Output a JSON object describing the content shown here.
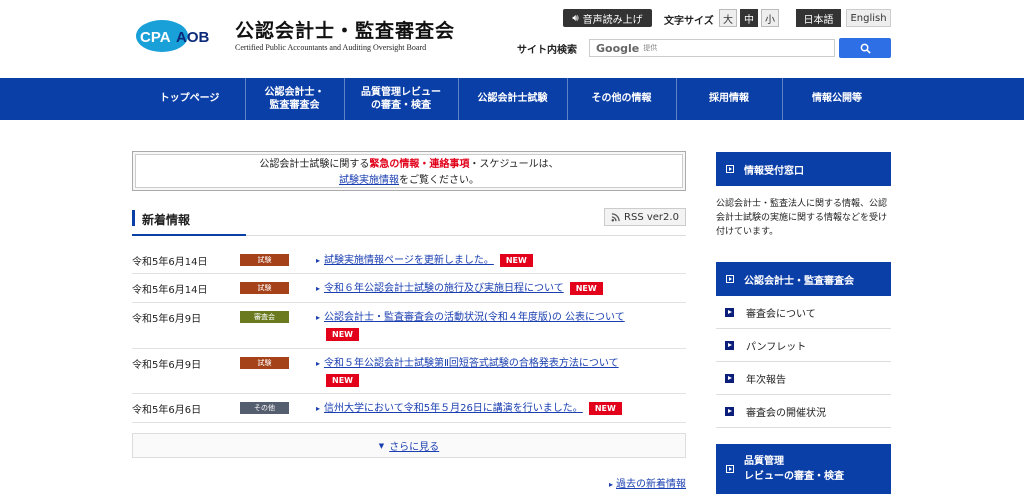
{
  "header": {
    "logo_mark": "CPAAOB",
    "logo_title": "公認会計士・監査審査会",
    "logo_subtitle": "Certified Public Accountants and Auditing Oversight Board",
    "voice_button": "音声読み上げ",
    "fontsize_label": "文字サイズ",
    "fontsize_options": [
      "大",
      "中",
      "小"
    ],
    "lang_ja": "日本語",
    "lang_en": "English",
    "search_label": "サイト内検索",
    "search_google": "Google",
    "search_placeholder": "提供"
  },
  "nav": {
    "items": [
      {
        "label": "トップページ"
      },
      {
        "label": "公認会計士・\n監査審査会"
      },
      {
        "label": "品質管理レビュー\nの審査・検査"
      },
      {
        "label": "公認会計士試験"
      },
      {
        "label": "その他の情報"
      },
      {
        "label": "採用情報"
      },
      {
        "label": "情報公開等"
      }
    ]
  },
  "notice": {
    "prefix": "公認会計士試験に関する",
    "highlight": "緊急の情報・連絡事項",
    "suffix": "・スケジュールは、",
    "link": "試験実施情報",
    "tail": "をご覧ください。"
  },
  "news": {
    "title": "新着情報",
    "rss": "RSS ver2.0",
    "items": [
      {
        "date": "令和5年6月14日",
        "category": "試験",
        "text": "試験実施情報ページを更新しました。",
        "new": "NEW"
      },
      {
        "date": "令和5年6月14日",
        "category": "試験",
        "text": "令和６年公認会計士試験の施行及び実施日程について",
        "new": "NEW"
      },
      {
        "date": "令和5年6月9日",
        "category": "審査会",
        "text": "公認会計士・監査審査会の活動状況(令和４年度版)の 公表について",
        "new": "NEW"
      },
      {
        "date": "令和5年6月9日",
        "category": "試験",
        "text": "令和５年公認会計士試験第Ⅱ回短答式試験の合格発表方法について",
        "new": "NEW"
      },
      {
        "date": "令和5年6月6日",
        "category": "その他",
        "text": "信州大学において令和5年５月26日に講演を行いました。",
        "new": "NEW"
      }
    ],
    "more": "さらに見る",
    "past": "過去の新着情報"
  },
  "sidebar": {
    "info_head": "情報受付窓口",
    "info_desc": "公認会計士・監査法人に関する情報、公認会計士試験の実施に関する情報などを受け付けています。",
    "board_head": "公認会計士・監査審査会",
    "board_items": [
      "審査会について",
      "パンフレット",
      "年次報告",
      "審査会の開催状況"
    ],
    "review_head_1": "品質管理",
    "review_head_2": "レビューの審査・検査"
  },
  "colors": {
    "brand_blue": "#0b3fa8",
    "new_red": "#e2001a",
    "badge_exam": "#a6421a",
    "badge_board": "#6b7a1e",
    "badge_other": "#555e6e"
  }
}
